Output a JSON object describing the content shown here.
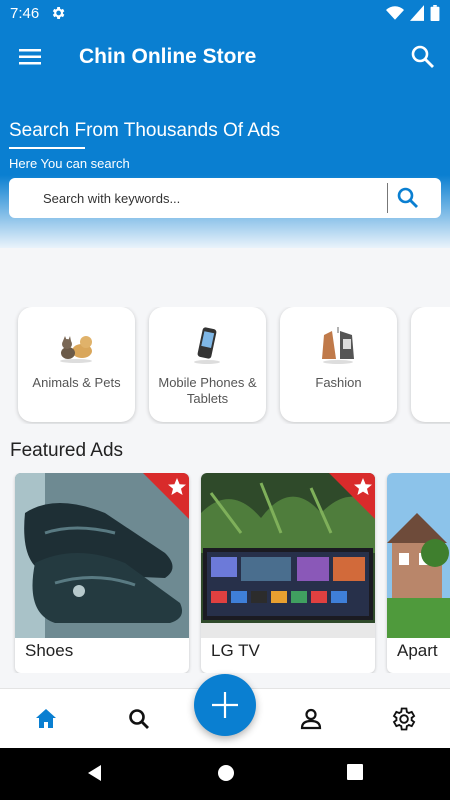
{
  "status_bar": {
    "time": "7:46"
  },
  "app_bar": {
    "title": "Chin Online Store"
  },
  "hero": {
    "title": "Search From Thousands Of Ads",
    "subtitle": "Here You can search",
    "search_placeholder": "Search with keywords..."
  },
  "categories": [
    {
      "label": "Animals & Pets",
      "icon": "pets-icon"
    },
    {
      "label": "Mobile Phones & Tablets",
      "icon": "phone-icon"
    },
    {
      "label": "Fashion",
      "icon": "fashion-icon"
    },
    {
      "label": "",
      "icon": "category-icon"
    }
  ],
  "featured": {
    "title": "Featured Ads",
    "items": [
      {
        "label": "Shoes"
      },
      {
        "label": "LG TV"
      },
      {
        "label": "Apart"
      }
    ]
  },
  "bottom_nav": [
    "home-icon",
    "search-icon",
    "add-icon",
    "profile-icon",
    "settings-icon"
  ],
  "colors": {
    "primary": "#0a7fd1",
    "badge": "#d92b2b"
  }
}
